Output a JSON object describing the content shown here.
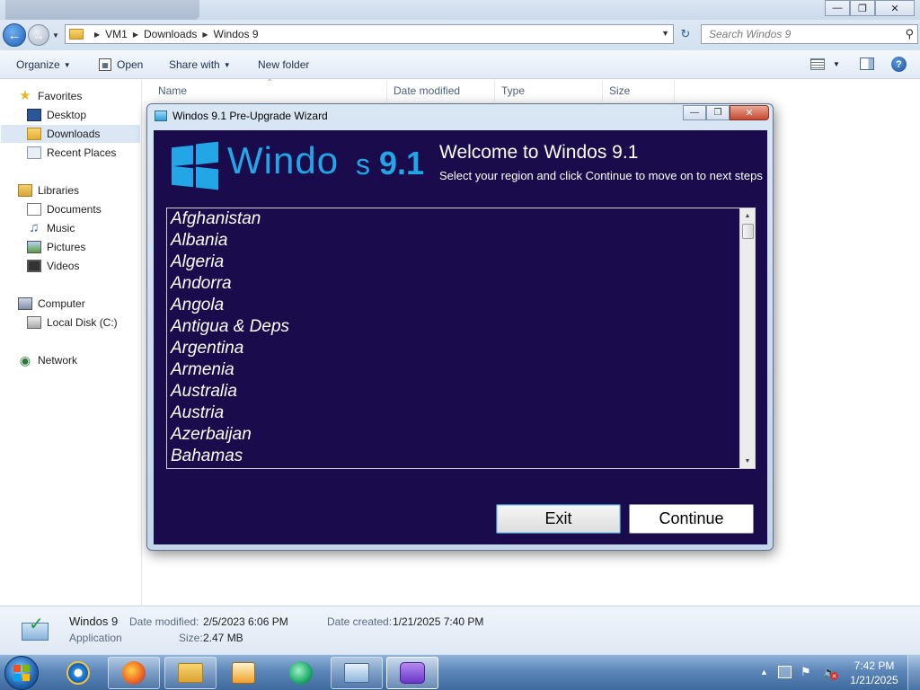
{
  "explorer": {
    "window_buttons": {
      "minimize": "—",
      "restore": "❐",
      "close": "✕"
    },
    "breadcrumbs": [
      "VM1",
      "Downloads",
      "Windos 9"
    ],
    "search": {
      "placeholder": "Search Windos 9",
      "value": ""
    },
    "toolbar": {
      "organize": "Organize",
      "open": "Open",
      "share_with": "Share with",
      "new_folder": "New folder"
    },
    "nav": {
      "favorites": "Favorites",
      "desktop": "Desktop",
      "downloads": "Downloads",
      "recent_places": "Recent Places",
      "libraries": "Libraries",
      "documents": "Documents",
      "music": "Music",
      "pictures": "Pictures",
      "videos": "Videos",
      "computer": "Computer",
      "local_disk": "Local Disk (C:)",
      "network": "Network"
    },
    "columns": [
      "Name",
      "Date modified",
      "Type",
      "Size"
    ],
    "details": {
      "name": "Windos 9",
      "type": "Application",
      "date_modified_label": "Date modified:",
      "date_modified": "2/5/2023 6:06 PM",
      "size_label": "Size:",
      "size": "2.47 MB",
      "date_created_label": "Date created:",
      "date_created": "1/21/2025 7:40 PM"
    }
  },
  "wizard": {
    "title": "Windos 9.1 Pre-Upgrade Wizard",
    "logo": {
      "main": "Windo",
      "s": "s",
      "version": "9.1"
    },
    "welcome_title": "Welcome to Windos 9.1",
    "welcome_subtitle": "Select your region and click Continue to move on to next steps",
    "regions": [
      "Afghanistan",
      "Albania",
      "Algeria",
      "Andorra",
      "Angola",
      "Antigua & Deps",
      "Argentina",
      "Armenia",
      "Australia",
      "Austria",
      "Azerbaijan",
      "Bahamas"
    ],
    "buttons": {
      "exit": "Exit",
      "continue": "Continue"
    }
  },
  "taskbar": {
    "clock_time": "7:42 PM",
    "clock_date": "1/21/2025"
  },
  "colors": {
    "wizard_background": "#1a0c4c",
    "logo_blue": "#22a6e6",
    "taskbar": "#5c86b8"
  }
}
